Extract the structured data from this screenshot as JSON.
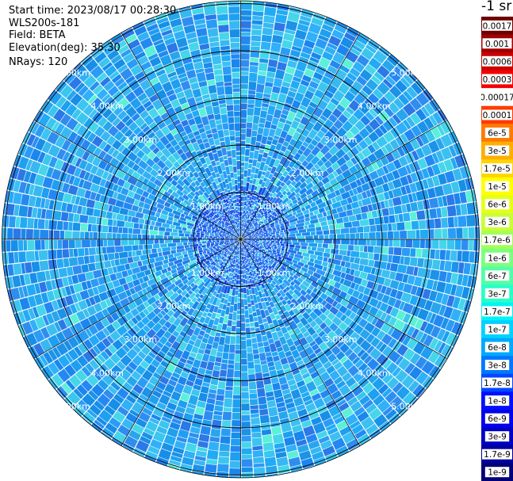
{
  "header": {
    "start_time": "Start time: 2023/08/17 00:28:30",
    "instrument": "WLS200s-181",
    "field": "Field: BETA",
    "elevation": "Elevation(deg): 35.30",
    "nrays": "NRays: 120"
  },
  "colorbar": {
    "unit_label": "-1 sr",
    "labels": [
      "0.0017",
      "0.001",
      "0.0006",
      "0.0003",
      "0.00017",
      "0.0001",
      "6e-5",
      "3e-5",
      "1.7e-5",
      "1e-5",
      "6e-6",
      "3e-6",
      "1.7e-6",
      "1e-6",
      "6e-7",
      "3e-7",
      "1.7e-7",
      "1e-7",
      "6e-8",
      "3e-8",
      "1.7e-8",
      "1e-8",
      "6e-9",
      "3e-9",
      "1.7e-9",
      "1e-9"
    ],
    "colors": [
      "#6e0000",
      "#a00000",
      "#cc0000",
      "#f20000",
      "#ffffff",
      "#ff3a00",
      "#ff7a00",
      "#ffae00",
      "#ffd400",
      "#ffff00",
      "#e6ff18",
      "#c8ff36",
      "#a2ff5a",
      "#7cff7e",
      "#52ffa6",
      "#2affc8",
      "#00f4f4",
      "#00d2ff",
      "#00a8ff",
      "#0078ff",
      "#0048ff",
      "#0010ff",
      "#0000ec",
      "#0000c4",
      "#00009e",
      "#000078"
    ]
  },
  "chart_data": {
    "type": "heatmap",
    "title": "",
    "projection": "PPI polar scan",
    "nrays": 120,
    "range_rings_km": [
      "1.00km",
      "2.00km",
      "3.00km",
      "4.00km",
      "5.00km"
    ],
    "field": "BETA",
    "dominant_value_range": [
      "1e-7",
      "1.7e-7"
    ],
    "grid": true
  }
}
